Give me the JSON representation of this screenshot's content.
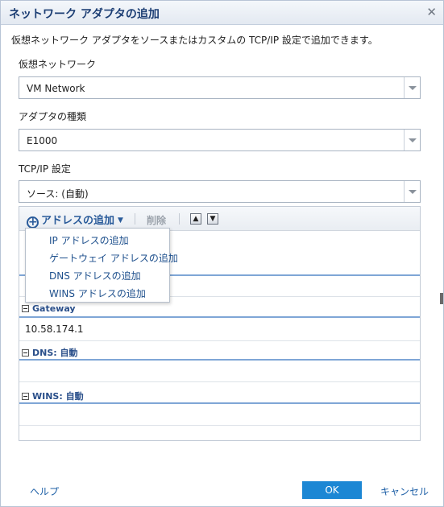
{
  "dialog": {
    "title": "ネットワーク アダプタの追加",
    "description": "仮想ネットワーク アダプタをソースまたはカスタムの TCP/IP 設定で追加できます。"
  },
  "fields": {
    "network_label": "仮想ネットワーク",
    "network_value": "VM Network",
    "adapter_label": "アダプタの種類",
    "adapter_value": "E1000",
    "tcpip_label": "TCP/IP 設定",
    "tcpip_value": "ソース: (自動)"
  },
  "toolbar": {
    "add_label": "アドレスの追加",
    "delete_label": "削除",
    "move_up": "up-arrow-icon",
    "move_down": "down-arrow-icon"
  },
  "add_menu": {
    "items": [
      "IP アドレスの追加",
      "ゲートウェイ アドレスの追加",
      "DNS アドレスの追加",
      "WINS アドレスの追加"
    ]
  },
  "sections": {
    "gateway_title": "Gateway",
    "gateway_value": "10.58.174.1",
    "dns_title": "DNS: 自動",
    "wins_title": "WINS: 自動"
  },
  "footer": {
    "help": "ヘルプ",
    "ok": "OK",
    "cancel": "キャンセル"
  },
  "colors": {
    "title": "#1b3d73",
    "accent": "#1c87d4",
    "link": "#1d5fa6"
  }
}
